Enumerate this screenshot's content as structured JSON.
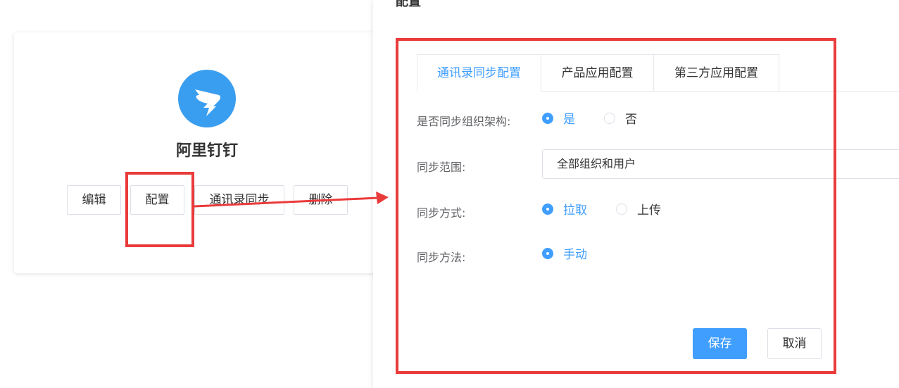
{
  "app_card": {
    "name": "阿里钉钉",
    "logo_icon": "dingtalk-icon",
    "buttons": {
      "edit": "编辑",
      "configure": "配置",
      "sync": "通讯录同步",
      "delete": "删除"
    }
  },
  "drawer": {
    "title": "配置",
    "tabs": [
      "通讯录同步配置",
      "产品应用配置",
      "第三方应用配置"
    ],
    "form": {
      "sync_org_label": "是否同步组织架构:",
      "sync_org_yes": "是",
      "sync_org_no": "否",
      "sync_scope_label": "同步范围:",
      "sync_scope_value": "全部组织和用户",
      "sync_mode_label": "同步方式:",
      "sync_mode_pull": "拉取",
      "sync_mode_upload": "上传",
      "sync_method_label": "同步方法:",
      "sync_method_manual": "手动"
    },
    "buttons": {
      "save": "保存",
      "cancel": "取消"
    }
  },
  "colors": {
    "accent": "#409eff",
    "highlight": "#ea3b3b",
    "logo": "#3a9ef0"
  }
}
